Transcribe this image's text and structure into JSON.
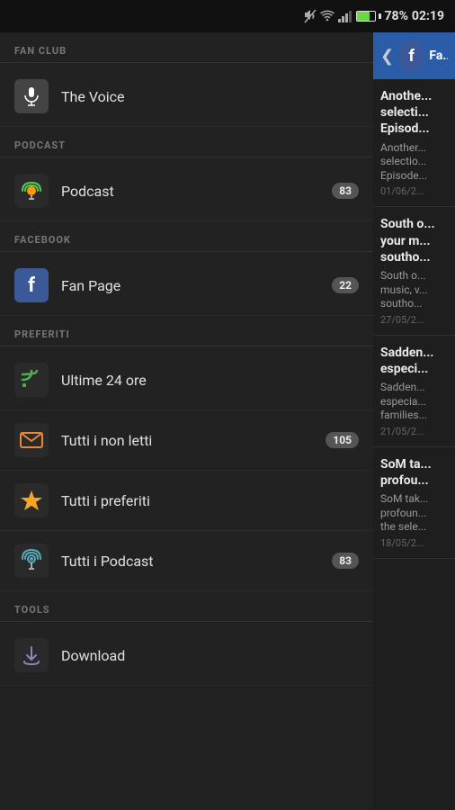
{
  "statusBar": {
    "battery": "78%",
    "time": "02:19",
    "batteryColor": "#6cd644"
  },
  "sidebar": {
    "sections": [
      {
        "id": "fan-club",
        "label": "FAN CLUB",
        "items": [
          {
            "id": "the-voice",
            "label": "The Voice",
            "icon": "mic",
            "badge": null
          }
        ]
      },
      {
        "id": "podcast",
        "label": "PODCAST",
        "items": [
          {
            "id": "podcast",
            "label": "Podcast",
            "icon": "podcast",
            "badge": "83"
          }
        ]
      },
      {
        "id": "facebook",
        "label": "FACEBOOK",
        "items": [
          {
            "id": "fan-page",
            "label": "Fan Page",
            "icon": "facebook",
            "badge": "22"
          }
        ]
      },
      {
        "id": "preferiti",
        "label": "PREFERITI",
        "items": [
          {
            "id": "ultime-24-ore",
            "label": "Ultime 24 ore",
            "icon": "rss",
            "badge": null
          },
          {
            "id": "tutti-non-letti",
            "label": "Tutti i non letti",
            "icon": "unread",
            "badge": "105"
          },
          {
            "id": "tutti-preferiti",
            "label": "Tutti i preferiti",
            "icon": "star",
            "badge": null
          },
          {
            "id": "tutti-podcast",
            "label": "Tutti i Podcast",
            "icon": "podcast2",
            "badge": "83"
          }
        ]
      },
      {
        "id": "tools",
        "label": "TOOLS",
        "items": [
          {
            "id": "download",
            "label": "Download",
            "icon": "download",
            "badge": null
          }
        ]
      }
    ]
  },
  "rightPanel": {
    "headerTitle": "Fa...",
    "feeds": [
      {
        "id": "feed-1",
        "title": "Anothe... selecti... Episod...",
        "excerpt": "Another... selectio... Episode...",
        "date": "01/06/2..."
      },
      {
        "id": "feed-2",
        "title": "South o... your m... southo...",
        "excerpt": "South o... music, v... southo...",
        "date": "27/05/2..."
      },
      {
        "id": "feed-3",
        "title": "Sadden... especi...",
        "excerpt": "Sadden... especia... families...",
        "date": "21/05/2..."
      },
      {
        "id": "feed-4",
        "title": "SoM ta... profou...",
        "excerpt": "SoM tak... profoun... the sele...",
        "date": "18/05/2..."
      }
    ]
  }
}
